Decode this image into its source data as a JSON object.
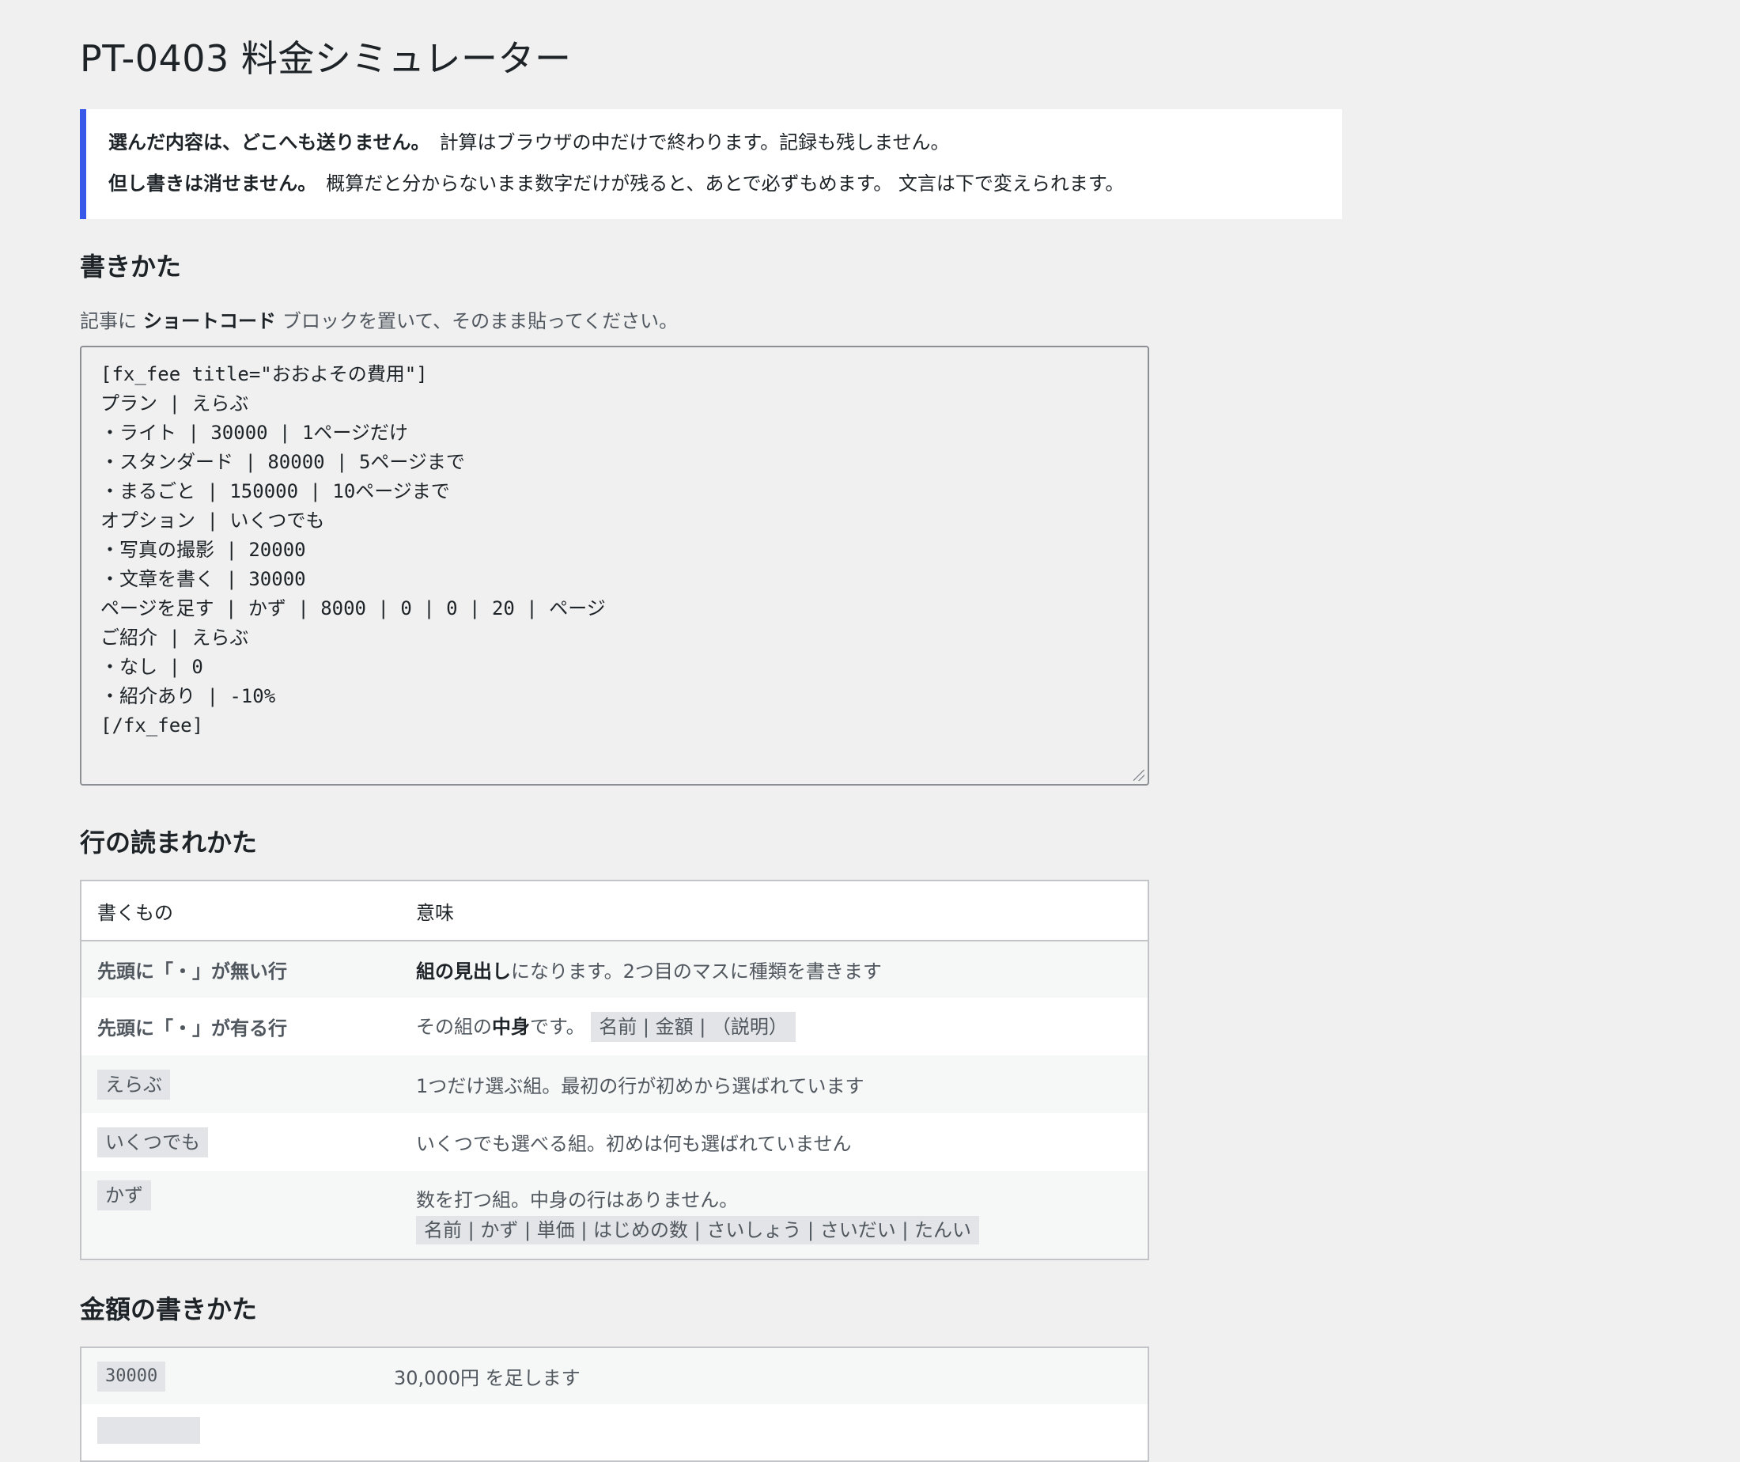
{
  "page_title": "PT-0403 料金シミュレーター",
  "notice": {
    "line1_strong": "選んだ内容は、どこへも送りません。",
    "line1_text": "計算はブラウザの中だけで終わります。記録も残しません。",
    "line2_strong": "但し書きは消せません。",
    "line2_text": "概算だと分からないまま数字だけが残ると、あとで必ずもめます。 文言は下で変えられます。"
  },
  "usage": {
    "heading": "書きかた",
    "desc_pre": "記事に",
    "desc_bold": "ショートコード",
    "desc_post": "ブロックを置いて、そのまま貼ってください。",
    "code": "[fx_fee title=\"おおよその費用\"]\nプラン | えらぶ\n・ライト | 30000 | 1ページだけ\n・スタンダード | 80000 | 5ページまで\n・まるごと | 150000 | 10ページまで\nオプション | いくつでも\n・写真の撮影 | 20000\n・文章を書く | 30000\nページを足す | かず | 8000 | 0 | 0 | 20 | ページ\nご紹介 | えらぶ\n・なし | 0\n・紹介あり | -10%\n[/fx_fee]"
  },
  "rows_section": {
    "heading": "行の読まれかた",
    "col1": "書くもの",
    "col2": "意味",
    "r1_key": "先頭に「・」が無い行",
    "r1_bold": "組の見出し",
    "r1_text": "になります。2つ目のマスに種類を書きます",
    "r2_key": "先頭に「・」が有る行",
    "r2_pre": "その組の",
    "r2_bold": "中身",
    "r2_post": "です。",
    "r2_tag": "名前 | 金額 | （説明）",
    "r3_key": "えらぶ",
    "r3_text": "1つだけ選ぶ組。最初の行が初めから選ばれています",
    "r4_key": "いくつでも",
    "r4_text": "いくつでも選べる組。初めは何も選ばれていません",
    "r5_key": "かず",
    "r5_text": "数を打つ組。中身の行はありません。",
    "r5_tag": "名前 | かず | 単価 | はじめの数 | さいしょう | さいだい | たんい"
  },
  "amount_section": {
    "heading": "金額の書きかた",
    "r1_key": "30000",
    "r1_text": "30,000円 を足します"
  }
}
